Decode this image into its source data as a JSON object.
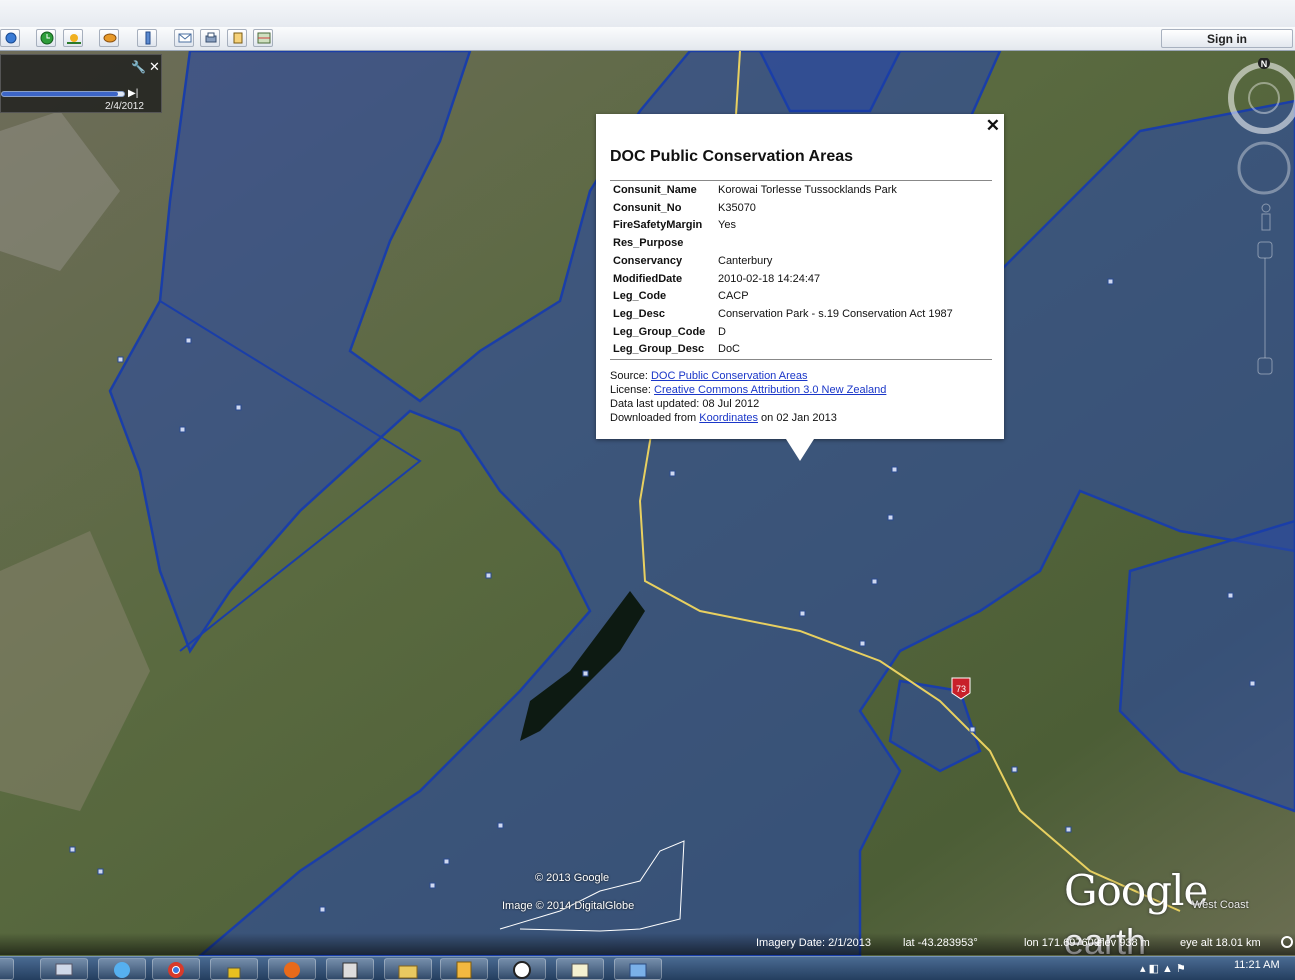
{
  "toolbar": {
    "sign_in_label": "Sign in",
    "buttons": [
      "placemark-icon",
      "sun-icon",
      "planets-icon",
      "ruler-icon",
      "email-icon",
      "print-icon",
      "save-image-icon",
      "maps-icon"
    ]
  },
  "time_slider": {
    "end_date": "2/4/2012",
    "progress": 0.95
  },
  "balloon": {
    "title": "DOC Public Conservation Areas",
    "close_label": "✕",
    "attributes": [
      {
        "key": "Consunit_Name",
        "value": "Korowai Torlesse Tussocklands Park"
      },
      {
        "key": "Consunit_No",
        "value": "K35070"
      },
      {
        "key": "FireSafetyMargin",
        "value": "Yes"
      },
      {
        "key": "Res_Purpose",
        "value": ""
      },
      {
        "key": "Conservancy",
        "value": "Canterbury"
      },
      {
        "key": "ModifiedDate",
        "value": "2010-02-18 14:24:47"
      },
      {
        "key": "Leg_Code",
        "value": "CACP"
      },
      {
        "key": "Leg_Desc",
        "value": "Conservation Park - s.19 Conservation Act 1987"
      },
      {
        "key": "Leg_Group_Code",
        "value": "D"
      },
      {
        "key": "Leg_Group_Desc",
        "value": "DoC"
      }
    ],
    "source_prefix": "Source: ",
    "source_link": "DOC Public Conservation Areas",
    "license_prefix": "License: ",
    "license_link": "Creative Commons Attribution 3.0 New Zealand",
    "updated": "Data last updated: 08 Jul 2012",
    "downloaded_prefix": "Downloaded from ",
    "downloaded_link": "Koordinates",
    "downloaded_suffix": " on 02 Jan 2013"
  },
  "map": {
    "copyright_google": "© 2013 Google",
    "copyright_image": "Image © 2014 DigitalGlobe",
    "logo_main": "Google",
    "logo_sub": "earth",
    "place_label": "West Coast",
    "road_shield": "73",
    "compass_north": "N"
  },
  "status": {
    "imagery_date": "Imagery Date: 2/1/2013",
    "lat": "lat  -43.283953°",
    "lon": "lon  171.697609°",
    "elev": "elev   938 m",
    "eye_alt": "eye alt  18.01 km"
  },
  "taskbar": {
    "clock": "11:21 AM",
    "apps": [
      "network-icon",
      "ie-icon",
      "chrome-icon",
      "lock-app-icon",
      "firefox-icon",
      "calculator-icon",
      "folder-icon",
      "notes-icon",
      "steering-wheel-icon",
      "chart-app-icon",
      "settings-app-icon"
    ]
  },
  "colors": {
    "conservation_fill": "#2b4aa0",
    "conservation_border": "#1a3ea8",
    "link": "#1a36c8"
  }
}
